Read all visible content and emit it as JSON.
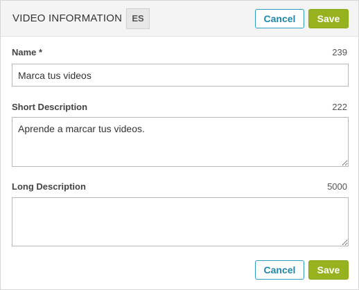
{
  "header": {
    "title": "VIDEO INFORMATION",
    "language": "ES",
    "cancel_label": "Cancel",
    "save_label": "Save"
  },
  "fields": {
    "name": {
      "label": "Name *",
      "count": "239",
      "value": "Marca tus videos"
    },
    "short_description": {
      "label": "Short Description",
      "count": "222",
      "value": "Aprende a marcar tus videos."
    },
    "long_description": {
      "label": "Long Description",
      "count": "5000",
      "value": ""
    }
  },
  "footer": {
    "cancel_label": "Cancel",
    "save_label": "Save"
  },
  "colors": {
    "cancel_border": "#2b9cc2",
    "save_bg": "#97b21f",
    "header_bg": "#f4f4f4"
  }
}
